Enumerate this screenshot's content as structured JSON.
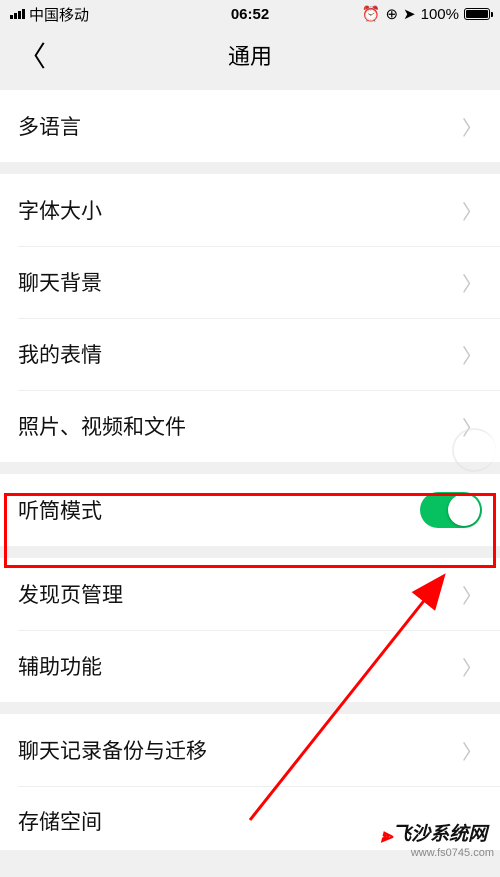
{
  "status": {
    "carrier": "中国移动",
    "time": "06:52",
    "battery_pct": "100%",
    "icons": "⏰ ⊕ ↗"
  },
  "nav": {
    "title": "通用"
  },
  "rows": {
    "multilang": "多语言",
    "fontsize": "字体大小",
    "chatbg": "聊天背景",
    "stickers": "我的表情",
    "media": "照片、视频和文件",
    "earpiece": "听筒模式",
    "discover": "发现页管理",
    "accessibility": "辅助功能",
    "backup": "聊天记录备份与迁移",
    "storage": "存储空间"
  },
  "watermark": {
    "name": "飞沙系统网",
    "url": "www.fs0745.com"
  },
  "toggle": {
    "earpiece_on": true
  }
}
